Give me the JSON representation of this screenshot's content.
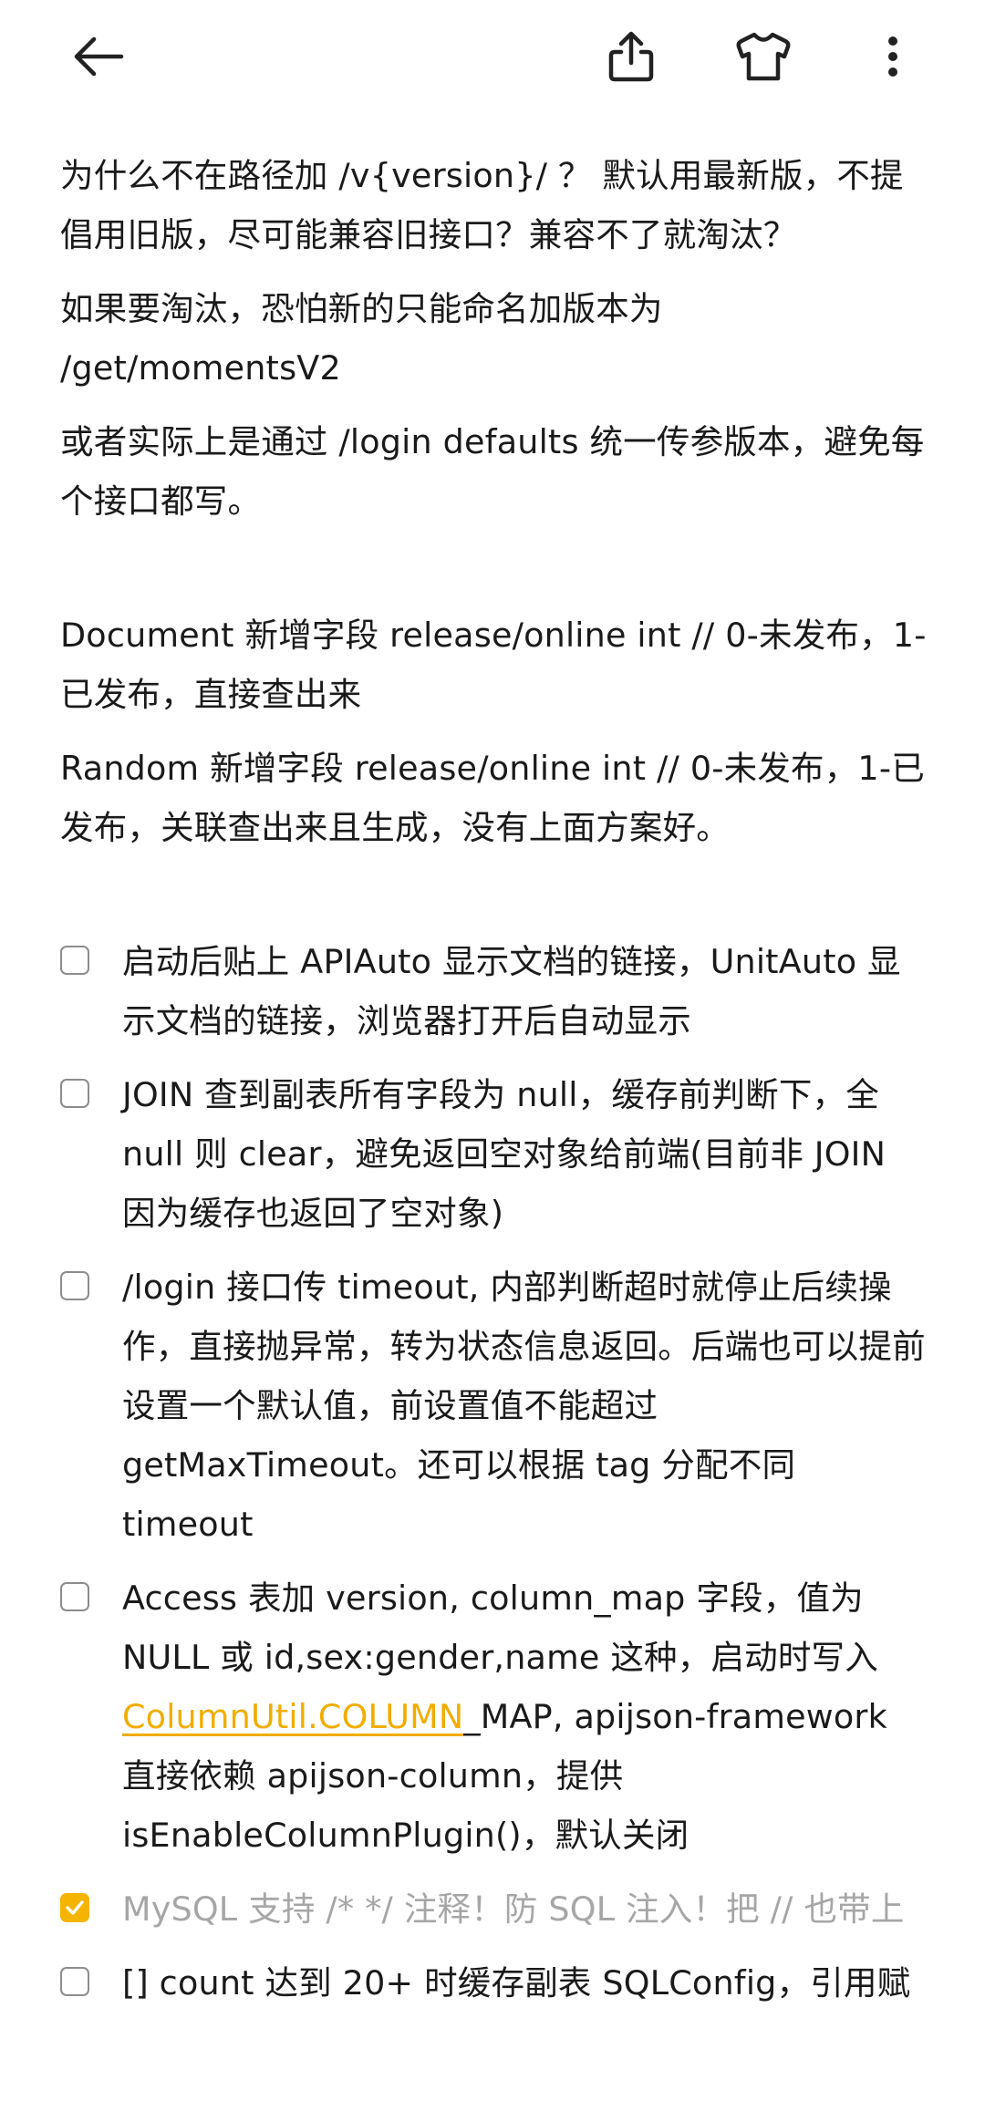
{
  "toolbar": {
    "icons": [
      "back-arrow-icon",
      "share-icon",
      "theme-shirt-icon",
      "more-vert-icon"
    ]
  },
  "colors": {
    "accent": "#f5b400",
    "link": "#f0ad00",
    "done_text": "#a6a6a6"
  },
  "paragraphs1": [
    "为什么不在路径加 /v{version}/ ？ 默认用最新版，不提倡用旧版，尽可能兼容旧接口？兼容不了就淘汰？",
    "如果要淘汰，恐怕新的只能命名加版本为 /get/momentsV2",
    "或者实际上是通过 /login defaults 统一传参版本，避免每个接口都写。"
  ],
  "paragraphs2": [
    "Document 新增字段 release/online int // 0-未发布，1-已发布，直接查出来",
    "Random 新增字段 release/online int // 0-未发布，1-已发布，关联查出来且生成，没有上面方案好。"
  ],
  "todos": [
    {
      "checked": false,
      "text": "启动后贴上 APIAuto 显示文档的链接，UnitAuto 显示文档的链接，浏览器打开后自动显示"
    },
    {
      "checked": false,
      "text": "JOIN 查到副表所有字段为 null，缓存前判断下，全 null 则 clear，避免返回空对象给前端(目前非 JOIN 因为缓存也返回了空对象)"
    },
    {
      "checked": false,
      "text": "/login 接口传 timeout, 内部判断超时就停止后续操作，直接抛异常，转为状态信息返回。后端也可以提前设置一个默认值，前设置值不能超过 getMaxTimeout。还可以根据 tag 分配不同 timeout"
    },
    {
      "checked": false,
      "text_before": "Access 表加 version, column_map 字段，值为 NULL 或 id,sex:gender,name 这种，启动时写入 ",
      "link": "ColumnUtil.COLUMN",
      "text_after": "_MAP, apijson-framework 直接依赖 apijson-column，提供 isEnableColumnPlugin()，默认关闭"
    },
    {
      "checked": true,
      "text": "MySQL 支持 /* */ 注释！防 SQL 注入！把 // 也带上"
    },
    {
      "checked": false,
      "text": "[] count 达到 20+ 时缓存副表 SQLConfig，引用赋"
    }
  ]
}
